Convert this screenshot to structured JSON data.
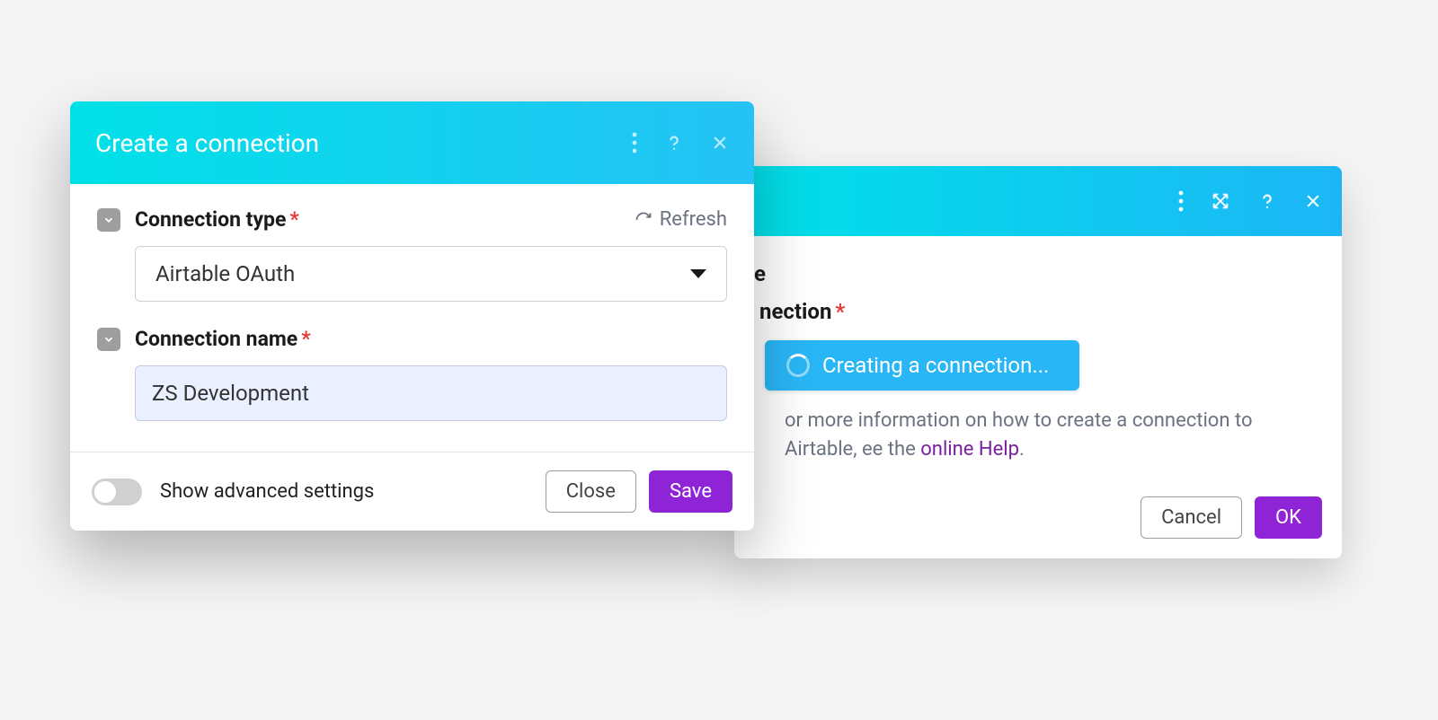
{
  "front": {
    "title": "Create a connection",
    "connection_type_label": "Connection type",
    "refresh_label": "Refresh",
    "connection_type_value": "Airtable OAuth",
    "connection_name_label": "Connection name",
    "connection_name_value": "ZS Development",
    "advanced_label": "Show advanced settings",
    "close_label": "Close",
    "save_label": "Save"
  },
  "back": {
    "title_fragment": "e",
    "connection_label_fragment": "nection",
    "add_label": "Creating a connection...",
    "help_text_pre": "or more information on how to create a connection to Airtable, ee the ",
    "help_link": "online Help",
    "help_text_post": ".",
    "cancel_label": "Cancel",
    "ok_label": "OK"
  }
}
